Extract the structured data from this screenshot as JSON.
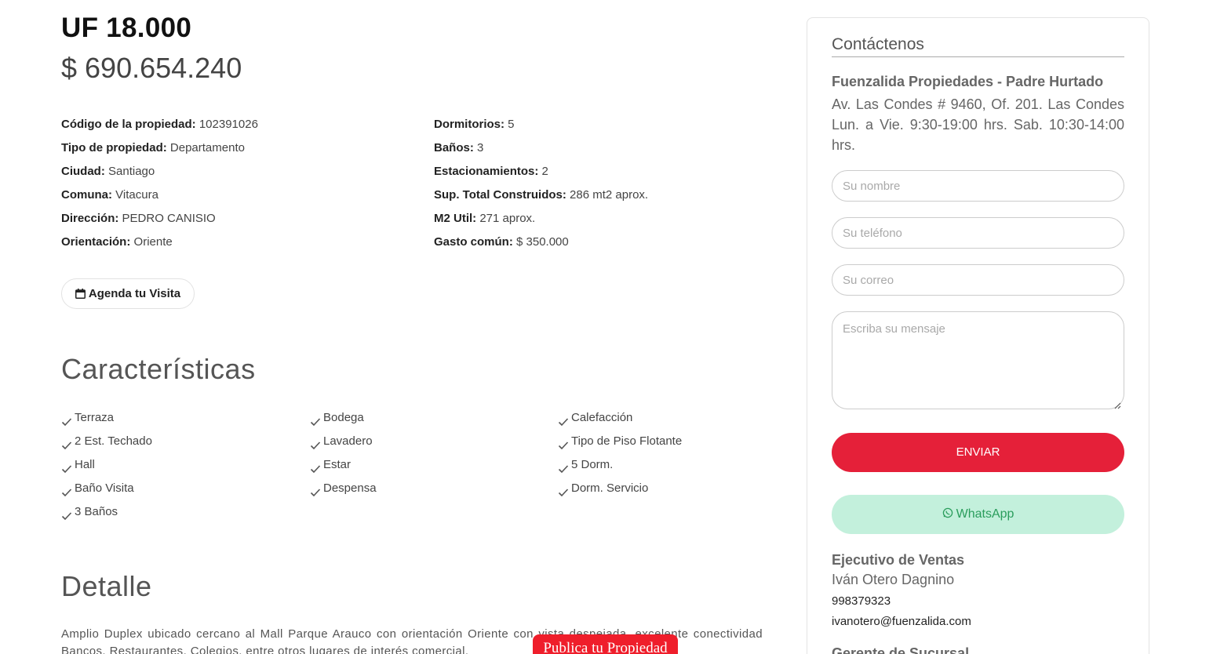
{
  "price": {
    "uf": "UF 18.000",
    "clp": "$ 690.654.240"
  },
  "properties_left": [
    {
      "label": "Código de la propiedad:",
      "value": "102391026"
    },
    {
      "label": "Tipo de propiedad:",
      "value": "Departamento"
    },
    {
      "label": "Ciudad:",
      "value": "Santiago"
    },
    {
      "label": "Comuna:",
      "value": "Vitacura"
    },
    {
      "label": "Dirección:",
      "value": "PEDRO CANISIO"
    },
    {
      "label": "Orientación:",
      "value": "Oriente"
    }
  ],
  "properties_right": [
    {
      "label": "Dormitorios:",
      "value": "5"
    },
    {
      "label": "Baños:",
      "value": "3"
    },
    {
      "label": "Estacionamientos:",
      "value": "2"
    },
    {
      "label": "Sup. Total Construidos:",
      "value": "286 mt2 aprox."
    },
    {
      "label": "M2 Util:",
      "value": "271 aprox."
    },
    {
      "label": "Gasto común:",
      "value": "$ 350.000"
    }
  ],
  "visit_button": {
    "label": "Agenda tu Visita",
    "icon": "calendar-icon"
  },
  "caracteristicas": {
    "title": "Características",
    "col1": [
      "Terraza",
      "2 Est. Techado",
      "Hall",
      "Baño Visita",
      "3 Baños"
    ],
    "col2": [
      "Bodega",
      "Lavadero",
      "Estar",
      "Despensa"
    ],
    "col3": [
      "Calefacción",
      "Tipo de Piso Flotante",
      "5 Dorm.",
      "Dorm. Servicio"
    ]
  },
  "detalle": {
    "title": "Detalle",
    "text": "Amplio Duplex ubicado cercano al Mall Parque Arauco con orientación Oriente con vista despejada, excelente conectividad Bancos, Restaurantes, Colegios, entre otros lugares de interés comercial."
  },
  "publish_button": {
    "label": "Publica tu Propiedad"
  },
  "contact": {
    "title": "Contáctenos",
    "office_name": "Fuenzalida Propiedades - Padre Hurtado",
    "office_address": "Av. Las Condes # 9460, Of. 201. Las Condes Lun. a Vie. 9:30-19:00 hrs. Sab. 10:30-14:00 hrs.",
    "placeholders": {
      "name": "Su nombre",
      "phone": "Su teléfono",
      "email": "Su correo",
      "message": "Escriba su mensaje"
    },
    "send_label": "ENVIAR",
    "whatsapp_label": "WhatsApp",
    "exec_title": "Ejecutivo de Ventas",
    "exec_name": "Iván Otero Dagnino",
    "exec_phone": "998379323",
    "exec_email": "ivanotero@fuenzalida.com",
    "next_title": "Gerente de Sucursal"
  },
  "colors": {
    "send": "#e52039",
    "whatsapp_bg": "#c3f0dc",
    "whatsapp_text": "#2a9d5c",
    "publish": "#ef1e2b"
  }
}
